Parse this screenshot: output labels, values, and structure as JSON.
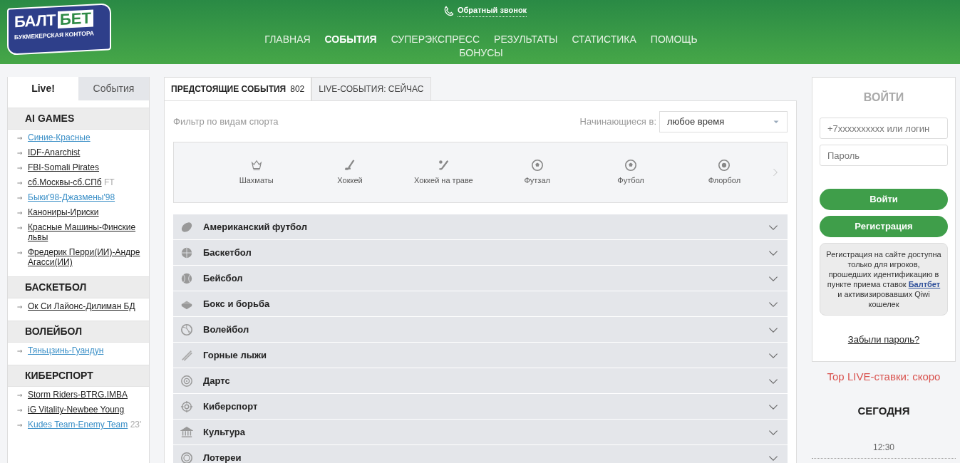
{
  "header": {
    "logo": {
      "word_1": "БАЛТ",
      "word_2": "БЕТ",
      "subtitle": "БУКМЕКЕРСКАЯ КОНТОРА"
    },
    "callback": "Обратный звонок",
    "nav": [
      {
        "label": "ГЛАВНАЯ",
        "selected": false
      },
      {
        "label": "СОБЫТИЯ",
        "selected": true
      },
      {
        "label": "СУПЕРЭКСПРЕСС",
        "selected": false
      },
      {
        "label": "РЕЗУЛЬТАТЫ",
        "selected": false
      },
      {
        "label": "СТАТИСТИКА",
        "selected": false
      },
      {
        "label": "ПОМОЩЬ",
        "selected": false
      },
      {
        "label": "БОНУСЫ",
        "selected": false
      }
    ]
  },
  "sidebar": {
    "tabs": [
      {
        "label": "Live!",
        "selected": true
      },
      {
        "label": "События",
        "selected": false
      }
    ],
    "groups": [
      {
        "title": "AI GAMES",
        "events": [
          {
            "name": "Синие-Красные",
            "highlighted": true
          },
          {
            "name": "IDF-Anarchist",
            "highlighted": false
          },
          {
            "name": "FBI-Somali Pirates",
            "highlighted": false
          },
          {
            "name": "сб.Москвы-сб.СПб",
            "highlighted": false,
            "status": "FT"
          },
          {
            "name": "Быки'98-Джазмены'98",
            "highlighted": true
          },
          {
            "name": "Канониры-Ириски",
            "highlighted": false
          },
          {
            "name": "Красные Машины-Финские львы",
            "highlighted": false
          },
          {
            "name": "Фредерик Перри(ИИ)-Андре Агасси(ИИ)",
            "highlighted": false
          }
        ]
      },
      {
        "title": "БАСКЕТБОЛ",
        "events": [
          {
            "name": "Ок Си Лайонс-Дилиман БД",
            "highlighted": false
          }
        ]
      },
      {
        "title": "ВОЛЕЙБОЛ",
        "events": [
          {
            "name": "Тяньцзинь-Гуандун",
            "highlighted": true
          }
        ]
      },
      {
        "title": "КИБЕРСПОРТ",
        "events": [
          {
            "name": "Storm Riders-BTRG.IMBA",
            "highlighted": false
          },
          {
            "name": "iG Vitality-Newbee Young",
            "highlighted": false
          },
          {
            "name": "Kudes Team-Enemy Team",
            "highlighted": true,
            "status": "23'"
          }
        ]
      }
    ]
  },
  "main": {
    "tabs": [
      {
        "label": "ПРЕДСТОЯЩИЕ СОБЫТИЯ",
        "count": "802",
        "selected": true
      },
      {
        "label": "LIVE-СОБЫТИЯ: СЕЙЧАС",
        "selected": false
      }
    ],
    "filter_label": "Фильтр по видам спорта",
    "start_label": "Начинающиеся в:",
    "start_value": "любое время",
    "carousel": [
      "Шахматы",
      "Хоккей",
      "Хоккей на траве",
      "Футзал",
      "Футбол",
      "Флорбол"
    ],
    "sports": [
      {
        "name": "Американский футбол",
        "expanded": false
      },
      {
        "name": "Баскетбол",
        "expanded": false
      },
      {
        "name": "Бейсбол",
        "expanded": false
      },
      {
        "name": "Бокс и борьба",
        "expanded": false
      },
      {
        "name": "Волейбол",
        "expanded": false
      },
      {
        "name": "Горные лыжи",
        "expanded": false
      },
      {
        "name": "Дартс",
        "expanded": false
      },
      {
        "name": "Киберспорт",
        "expanded": false
      },
      {
        "name": "Культура",
        "expanded": false
      },
      {
        "name": "Лотереи",
        "expanded": false
      }
    ]
  },
  "login": {
    "title": "ВОЙТИ",
    "login_placeholder": "+7xxxxxxxxxx или логин",
    "password_placeholder": "Пароль",
    "login_button": "Войти",
    "register_button": "Регистрация",
    "info_before": "Регистрация на сайте доступна только для игроков, прошедших идентификацию в пункте приема ставок",
    "info_link": "Балтбет",
    "info_after": "и активизировавших Qiwi кошелек",
    "forgot": "Забыли пароль?"
  },
  "top_live": "Top LIVE-ставки: скоро",
  "today": {
    "title": "СЕГОДНЯ",
    "time": "12:30"
  }
}
